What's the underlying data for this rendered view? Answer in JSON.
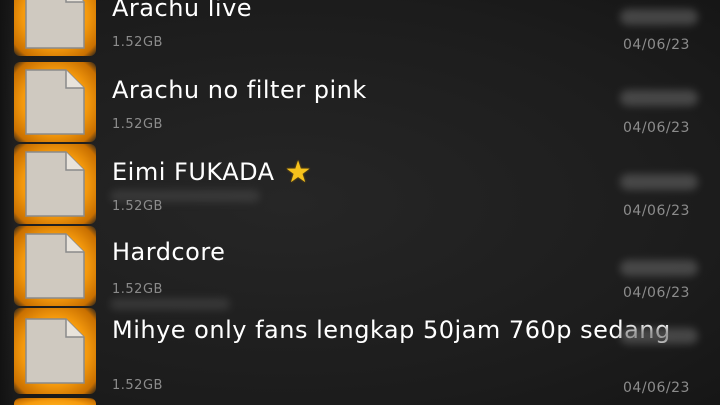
{
  "files": [
    {
      "name": "Arachu live",
      "size": "1.52GB",
      "date": "04/06/23"
    },
    {
      "name": "Arachu no filter pink",
      "size": "1.52GB",
      "date": "04/06/23"
    },
    {
      "name": "Eimi FUKADA",
      "size": "1.52GB",
      "date": "04/06/23",
      "star": "★"
    },
    {
      "name": "Hardcore",
      "size": "1.52GB",
      "date": "04/06/23"
    },
    {
      "name": "Mihye only fans lengkap 50jam 760p sedang",
      "size": "1.52GB",
      "date": "04/06/23"
    }
  ],
  "icons": {
    "file": "document-icon",
    "favorite": "star-icon"
  },
  "colors": {
    "background": "#1e1e1e",
    "icon_accent": "#f59a0d",
    "title_text": "#ffffff",
    "meta_text": "#8c8c8c",
    "star": "#f6c21c"
  }
}
